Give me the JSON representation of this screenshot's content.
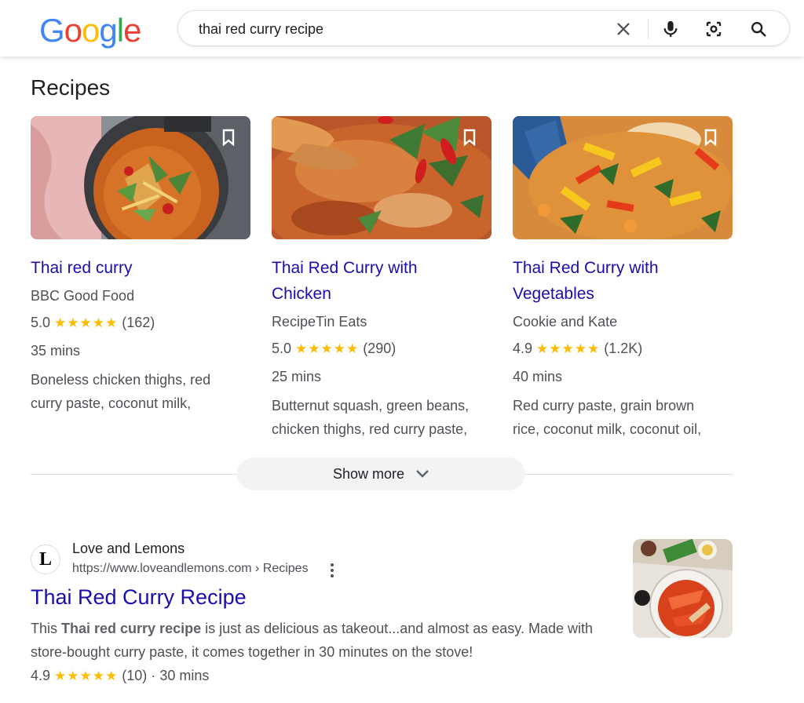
{
  "header": {
    "logo_text": "Google",
    "search": {
      "value": "thai red curry recipe",
      "placeholder": ""
    }
  },
  "recipes": {
    "title": "Recipes",
    "cards": [
      {
        "title_line1": "Thai red curry",
        "title_line2": "",
        "source": "BBC Good Food",
        "rating": "5.0",
        "stars": "★★★★★",
        "count": "(162)",
        "time": "35 mins",
        "ingredients_line1": "Boneless chicken thighs, red",
        "ingredients_line2": "curry paste, coconut milk,"
      },
      {
        "title_line1": "Thai Red Curry with",
        "title_line2": "Chicken",
        "source": "RecipeTin Eats",
        "rating": "5.0",
        "stars": "★★★★★",
        "count": "(290)",
        "time": "25 mins",
        "ingredients_line1": "Butternut squash, green beans,",
        "ingredients_line2": "chicken thighs, red curry paste,"
      },
      {
        "title_line1": "Thai Red Curry with",
        "title_line2": "Vegetables",
        "source": "Cookie and Kate",
        "rating": "4.9",
        "stars": "★★★★★",
        "count": "(1.2K)",
        "time": "40 mins",
        "ingredients_line1": "Red curry paste, grain brown",
        "ingredients_line2": "rice, coconut milk, coconut oil,"
      }
    ],
    "show_more": "Show more"
  },
  "result": {
    "favicon_letter": "L",
    "site_name": "Love and Lemons",
    "url": "https://www.loveandlemons.com › Recipes",
    "title": "Thai Red Curry Recipe",
    "snippet_pre": "This ",
    "snippet_bold": "Thai red curry recipe",
    "snippet_post": " is just as delicious as takeout...and almost as easy. Made with store-bought curry paste, it comes together in 30 minutes on the stove!",
    "rating": "4.9",
    "stars": "★★★★★",
    "count": "(10)",
    "separator": "·",
    "time": "30 mins"
  },
  "colors": {
    "link": "#1a0dab",
    "star": "#fbbc04",
    "text_secondary": "#4d5156"
  }
}
